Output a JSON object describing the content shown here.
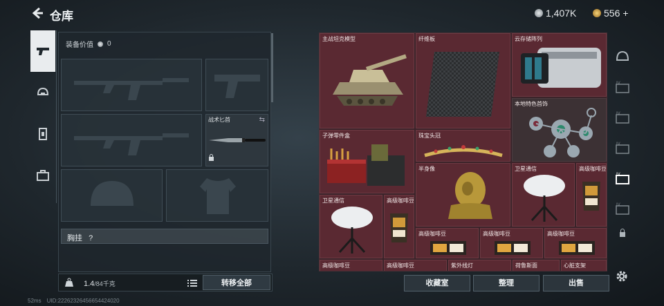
{
  "header": {
    "title": "仓库",
    "currency_silver": "1,407K",
    "currency_gold": "556",
    "gold_plus": "+"
  },
  "equipment": {
    "value_label": "装备价值",
    "value": "0",
    "knife_label": "战术匕首",
    "chest_rig_label": "胸挂",
    "chest_rig_help": "?"
  },
  "storage": {
    "weight_value": "1.4",
    "weight_capacity": "/84千克",
    "transfer_all_label": "转移全部"
  },
  "items": [
    {
      "label": "主战坦克模型",
      "icon": "tank-model-icon"
    },
    {
      "label": "纤维板",
      "icon": "fiberboard-icon"
    },
    {
      "label": "云存储阵列",
      "icon": "cloud-storage-icon"
    },
    {
      "label": "本地特色首饰",
      "icon": "jewelry-icon"
    },
    {
      "label": "子弹零件盒",
      "icon": "ammo-parts-box-icon"
    },
    {
      "label": "珠宝头冠",
      "icon": "tiara-icon"
    },
    {
      "label": "半身像",
      "icon": "bust-icon"
    },
    {
      "label": "卫星通信",
      "icon": "satellite-dish-icon"
    },
    {
      "label": "高级咖啡豆",
      "icon": "coffee-beans-icon"
    },
    {
      "label": "卫星通信",
      "icon": "satellite-dish-icon"
    },
    {
      "label": "高级咖啡豆",
      "icon": "coffee-beans-icon"
    },
    {
      "label": "高级咖啡豆",
      "icon": "coffee-box-icon"
    },
    {
      "label": "高级咖啡豆",
      "icon": "coffee-box-icon"
    },
    {
      "label": "高级咖啡豆",
      "icon": "coffee-box-icon"
    },
    {
      "label": "高级咖啡豆",
      "icon": "item-icon"
    },
    {
      "label": "高级咖啡豆",
      "icon": "item-icon"
    },
    {
      "label": "紫外线灯",
      "icon": "uv-lamp-icon"
    },
    {
      "label": "荷鲁斯面",
      "icon": "item-icon"
    },
    {
      "label": "心脏支架",
      "icon": "item-icon"
    }
  ],
  "actions": {
    "collection_label": "收藏室",
    "organize_label": "整理",
    "sell_label": "出售"
  },
  "status": {
    "ping": "52ms",
    "uid": "UID:2226232645665442402​0"
  },
  "colors": {
    "item_bg": "#5a2932",
    "panel_bg": "#1f272d",
    "accent": "#e9ecee"
  }
}
